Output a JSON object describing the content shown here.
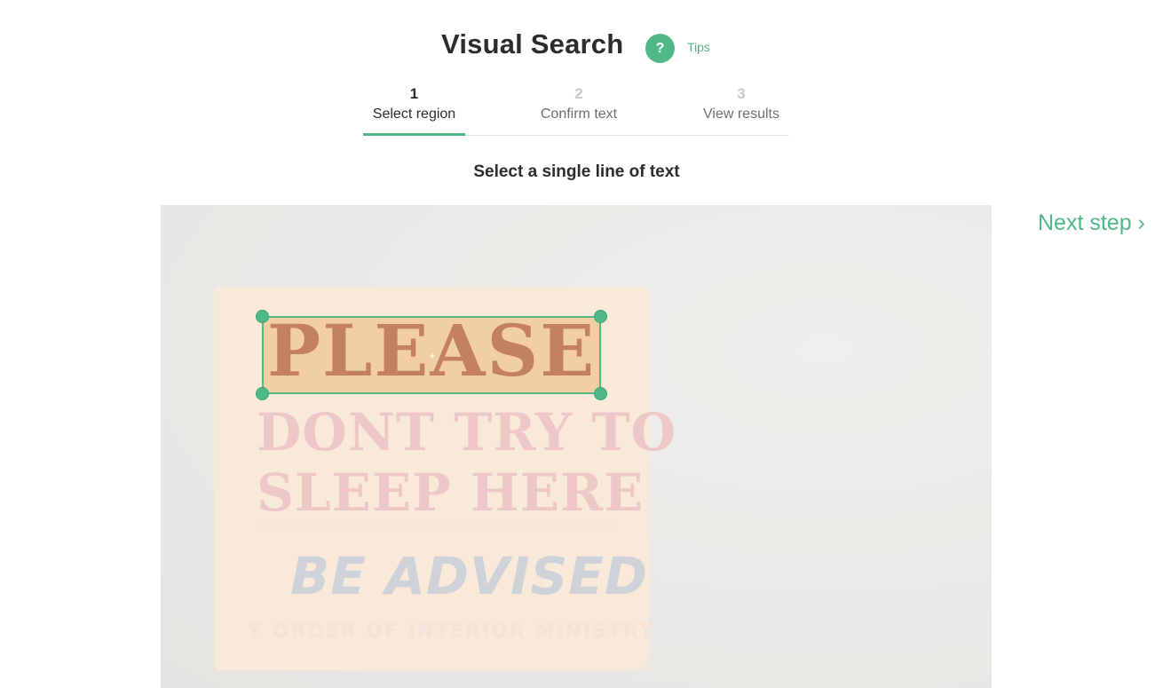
{
  "header": {
    "title": "Visual Search",
    "tips_icon": "?",
    "tips_label": "Tips"
  },
  "steps": [
    {
      "number": "1",
      "label": "Select region",
      "active": true
    },
    {
      "number": "2",
      "label": "Confirm text",
      "active": false
    },
    {
      "number": "3",
      "label": "View results",
      "active": false
    }
  ],
  "instruction": "Select a single line of text",
  "next_step_label": "Next step ›",
  "image": {
    "sign_lines": [
      "PLEASE",
      "DONT TRY TO",
      "SLEEP HERE",
      "BE ADVISED",
      "Y ORDER OF INTERIOR MINISTRY"
    ]
  },
  "colors": {
    "accent": "#4fb886",
    "text": "#2c2c2c",
    "muted": "#6e6e6e"
  },
  "icons": {
    "help": "question-mark-icon",
    "crosshair": "crosshair-icon",
    "next": "chevron-right-icon"
  }
}
